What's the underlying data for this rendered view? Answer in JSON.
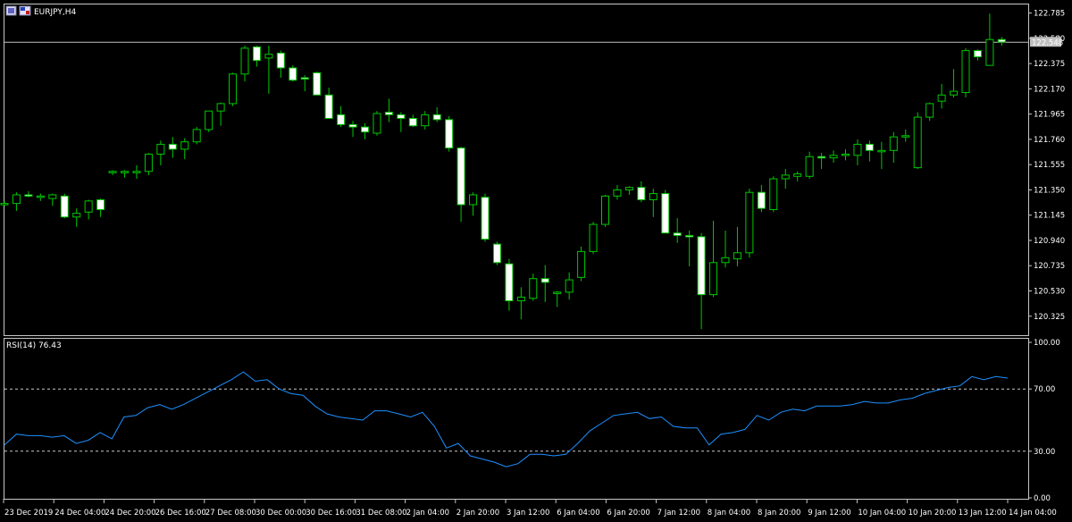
{
  "window": {
    "title": "EURJPY,H4",
    "icon_names": [
      "chart-window-icon",
      "flag-icon"
    ]
  },
  "colors": {
    "background": "#000000",
    "frame": "#c8c8c8",
    "bull_fill": "#000000",
    "bear_fill": "#ffffff",
    "wick": "#00c800",
    "rsi_line": "#1e90ff",
    "level_line": "#c8c8c8",
    "bid_line": "#c0c0c0",
    "price_tag_bg": "#c0c0c0",
    "price_tag_text": "#000000"
  },
  "chart_data": [
    {
      "type": "candlestick",
      "title": "EURJPY,H4",
      "ylim": [
        120.2,
        122.84
      ],
      "y_ticks": [
        "122.785",
        "122.580",
        "122.375",
        "122.170",
        "121.965",
        "121.760",
        "121.555",
        "121.350",
        "121.145",
        "120.940",
        "120.735",
        "120.530",
        "120.325"
      ],
      "x_labels": [
        "23 Dec 2019",
        "24 Dec 04:00",
        "24 Dec 20:00",
        "26 Dec 16:00",
        "27 Dec 08:00",
        "30 Dec 00:00",
        "30 Dec 16:00",
        "31 Dec 08:00",
        "2 Jan 04:00",
        "2 Jan 20:00",
        "3 Jan 12:00",
        "6 Jan 04:00",
        "6 Jan 20:00",
        "7 Jan 12:00",
        "8 Jan 04:00",
        "8 Jan 20:00",
        "9 Jan 12:00",
        "10 Jan 04:00",
        "10 Jan 20:00",
        "13 Jan 12:00",
        "14 Jan 04:00"
      ],
      "current_price": "122.548",
      "candles": [
        {
          "o": 121.24,
          "h": 121.26,
          "l": 121.22,
          "c": 121.24
        },
        {
          "o": 121.24,
          "h": 121.33,
          "l": 121.18,
          "c": 121.31
        },
        {
          "o": 121.31,
          "h": 121.34,
          "l": 121.29,
          "c": 121.3
        },
        {
          "o": 121.29,
          "h": 121.32,
          "l": 121.26,
          "c": 121.3
        },
        {
          "o": 121.28,
          "h": 121.32,
          "l": 121.22,
          "c": 121.31
        },
        {
          "o": 121.3,
          "h": 121.32,
          "l": 121.12,
          "c": 121.13
        },
        {
          "o": 121.13,
          "h": 121.2,
          "l": 121.05,
          "c": 121.16
        },
        {
          "o": 121.17,
          "h": 121.27,
          "l": 121.11,
          "c": 121.26
        },
        {
          "o": 121.27,
          "h": 121.28,
          "l": 121.13,
          "c": 121.19
        },
        {
          "o": 121.49,
          "h": 121.51,
          "l": 121.47,
          "c": 121.5
        },
        {
          "o": 121.49,
          "h": 121.51,
          "l": 121.45,
          "c": 121.5
        },
        {
          "o": 121.49,
          "h": 121.55,
          "l": 121.44,
          "c": 121.5
        },
        {
          "o": 121.5,
          "h": 121.65,
          "l": 121.47,
          "c": 121.64
        },
        {
          "o": 121.64,
          "h": 121.75,
          "l": 121.55,
          "c": 121.72
        },
        {
          "o": 121.72,
          "h": 121.78,
          "l": 121.61,
          "c": 121.68
        },
        {
          "o": 121.68,
          "h": 121.77,
          "l": 121.6,
          "c": 121.74
        },
        {
          "o": 121.74,
          "h": 121.86,
          "l": 121.72,
          "c": 121.84
        },
        {
          "o": 121.84,
          "h": 121.99,
          "l": 121.82,
          "c": 121.99
        },
        {
          "o": 121.99,
          "h": 122.06,
          "l": 121.87,
          "c": 122.05
        },
        {
          "o": 122.05,
          "h": 122.3,
          "l": 122.03,
          "c": 122.29
        },
        {
          "o": 122.29,
          "h": 122.52,
          "l": 122.23,
          "c": 122.5
        },
        {
          "o": 122.51,
          "h": 122.52,
          "l": 122.35,
          "c": 122.4
        },
        {
          "o": 122.42,
          "h": 122.52,
          "l": 122.13,
          "c": 122.45
        },
        {
          "o": 122.46,
          "h": 122.48,
          "l": 122.26,
          "c": 122.34
        },
        {
          "o": 122.34,
          "h": 122.36,
          "l": 122.23,
          "c": 122.24
        },
        {
          "o": 122.26,
          "h": 122.28,
          "l": 122.15,
          "c": 122.25
        },
        {
          "o": 122.3,
          "h": 122.31,
          "l": 122.19,
          "c": 122.12
        },
        {
          "o": 122.12,
          "h": 122.18,
          "l": 121.93,
          "c": 121.93
        },
        {
          "o": 121.96,
          "h": 122.03,
          "l": 121.86,
          "c": 121.88
        },
        {
          "o": 121.88,
          "h": 121.91,
          "l": 121.78,
          "c": 121.86
        },
        {
          "o": 121.86,
          "h": 121.89,
          "l": 121.76,
          "c": 121.82
        },
        {
          "o": 121.81,
          "h": 121.99,
          "l": 121.79,
          "c": 121.97
        },
        {
          "o": 121.98,
          "h": 122.09,
          "l": 121.9,
          "c": 121.96
        },
        {
          "o": 121.96,
          "h": 121.98,
          "l": 121.82,
          "c": 121.93
        },
        {
          "o": 121.93,
          "h": 121.96,
          "l": 121.86,
          "c": 121.87
        },
        {
          "o": 121.87,
          "h": 121.99,
          "l": 121.84,
          "c": 121.96
        },
        {
          "o": 121.96,
          "h": 122.02,
          "l": 121.9,
          "c": 121.92
        },
        {
          "o": 121.92,
          "h": 121.95,
          "l": 121.66,
          "c": 121.69
        },
        {
          "o": 121.69,
          "h": 121.7,
          "l": 121.09,
          "c": 121.23
        },
        {
          "o": 121.23,
          "h": 121.33,
          "l": 121.14,
          "c": 121.31
        },
        {
          "o": 121.29,
          "h": 121.32,
          "l": 120.93,
          "c": 120.95
        },
        {
          "o": 120.91,
          "h": 120.93,
          "l": 120.74,
          "c": 120.76
        },
        {
          "o": 120.75,
          "h": 120.79,
          "l": 120.37,
          "c": 120.45
        },
        {
          "o": 120.45,
          "h": 120.56,
          "l": 120.3,
          "c": 120.48
        },
        {
          "o": 120.47,
          "h": 120.67,
          "l": 120.45,
          "c": 120.63
        },
        {
          "o": 120.63,
          "h": 120.74,
          "l": 120.44,
          "c": 120.6
        },
        {
          "o": 120.51,
          "h": 120.53,
          "l": 120.4,
          "c": 120.52
        },
        {
          "o": 120.52,
          "h": 120.68,
          "l": 120.46,
          "c": 120.62
        },
        {
          "o": 120.64,
          "h": 120.89,
          "l": 120.61,
          "c": 120.85
        },
        {
          "o": 120.85,
          "h": 121.09,
          "l": 120.83,
          "c": 121.07
        },
        {
          "o": 121.07,
          "h": 121.31,
          "l": 121.05,
          "c": 121.3
        },
        {
          "o": 121.3,
          "h": 121.39,
          "l": 121.27,
          "c": 121.35
        },
        {
          "o": 121.35,
          "h": 121.38,
          "l": 121.31,
          "c": 121.37
        },
        {
          "o": 121.37,
          "h": 121.42,
          "l": 121.25,
          "c": 121.27
        },
        {
          "o": 121.27,
          "h": 121.36,
          "l": 121.13,
          "c": 121.32
        },
        {
          "o": 121.32,
          "h": 121.35,
          "l": 121.0,
          "c": 121.0
        },
        {
          "o": 121.0,
          "h": 121.12,
          "l": 120.92,
          "c": 120.98
        },
        {
          "o": 120.98,
          "h": 121.02,
          "l": 120.73,
          "c": 120.97
        },
        {
          "o": 120.97,
          "h": 121.0,
          "l": 120.22,
          "c": 120.5
        },
        {
          "o": 120.5,
          "h": 121.1,
          "l": 120.48,
          "c": 120.76
        },
        {
          "o": 120.76,
          "h": 121.02,
          "l": 120.72,
          "c": 120.8
        },
        {
          "o": 120.79,
          "h": 121.05,
          "l": 120.73,
          "c": 120.84
        },
        {
          "o": 120.84,
          "h": 121.36,
          "l": 120.8,
          "c": 121.33
        },
        {
          "o": 121.33,
          "h": 121.39,
          "l": 121.17,
          "c": 121.2
        },
        {
          "o": 121.19,
          "h": 121.46,
          "l": 121.17,
          "c": 121.44
        },
        {
          "o": 121.44,
          "h": 121.52,
          "l": 121.36,
          "c": 121.47
        },
        {
          "o": 121.46,
          "h": 121.5,
          "l": 121.42,
          "c": 121.48
        },
        {
          "o": 121.46,
          "h": 121.66,
          "l": 121.44,
          "c": 121.62
        },
        {
          "o": 121.62,
          "h": 121.65,
          "l": 121.52,
          "c": 121.61
        },
        {
          "o": 121.61,
          "h": 121.67,
          "l": 121.57,
          "c": 121.63
        },
        {
          "o": 121.63,
          "h": 121.68,
          "l": 121.59,
          "c": 121.64
        },
        {
          "o": 121.63,
          "h": 121.76,
          "l": 121.55,
          "c": 121.72
        },
        {
          "o": 121.72,
          "h": 121.75,
          "l": 121.58,
          "c": 121.67
        },
        {
          "o": 121.67,
          "h": 121.74,
          "l": 121.52,
          "c": 121.67
        },
        {
          "o": 121.67,
          "h": 121.82,
          "l": 121.57,
          "c": 121.78
        },
        {
          "o": 121.78,
          "h": 121.84,
          "l": 121.74,
          "c": 121.79
        },
        {
          "o": 121.53,
          "h": 121.98,
          "l": 121.52,
          "c": 121.94
        },
        {
          "o": 121.94,
          "h": 122.06,
          "l": 121.91,
          "c": 122.05
        },
        {
          "o": 122.07,
          "h": 122.21,
          "l": 122.01,
          "c": 122.12
        },
        {
          "o": 122.12,
          "h": 122.33,
          "l": 122.1,
          "c": 122.15
        },
        {
          "o": 122.14,
          "h": 122.5,
          "l": 122.1,
          "c": 122.48
        },
        {
          "o": 122.48,
          "h": 122.49,
          "l": 122.4,
          "c": 122.43
        },
        {
          "o": 122.36,
          "h": 122.78,
          "l": 122.36,
          "c": 122.57
        },
        {
          "o": 122.57,
          "h": 122.59,
          "l": 122.52,
          "c": 122.55
        }
      ]
    },
    {
      "type": "line",
      "title": "RSI(14) 76.43",
      "ylim": [
        0,
        100
      ],
      "y_ticks": [
        "100.00",
        "70.00",
        "30.00",
        "0.00"
      ],
      "levels": [
        70,
        30
      ],
      "values": [
        34,
        41,
        40,
        40,
        39,
        40,
        35,
        37,
        42,
        38,
        52,
        53,
        58,
        60,
        57,
        60,
        64,
        68,
        72,
        76,
        81,
        75,
        76,
        70,
        67,
        66,
        59,
        54,
        52,
        51,
        50,
        56,
        56,
        54,
        52,
        55,
        46,
        32,
        35,
        27,
        25,
        23,
        20,
        22,
        28,
        28,
        27,
        28,
        35,
        43,
        48,
        53,
        54,
        55,
        51,
        52,
        46,
        45,
        45,
        34,
        41,
        42,
        44,
        53,
        50,
        55,
        57,
        56,
        59,
        59,
        59,
        60,
        62,
        61,
        61,
        63,
        64,
        67,
        69,
        71,
        72,
        78,
        76,
        78,
        77
      ]
    }
  ]
}
